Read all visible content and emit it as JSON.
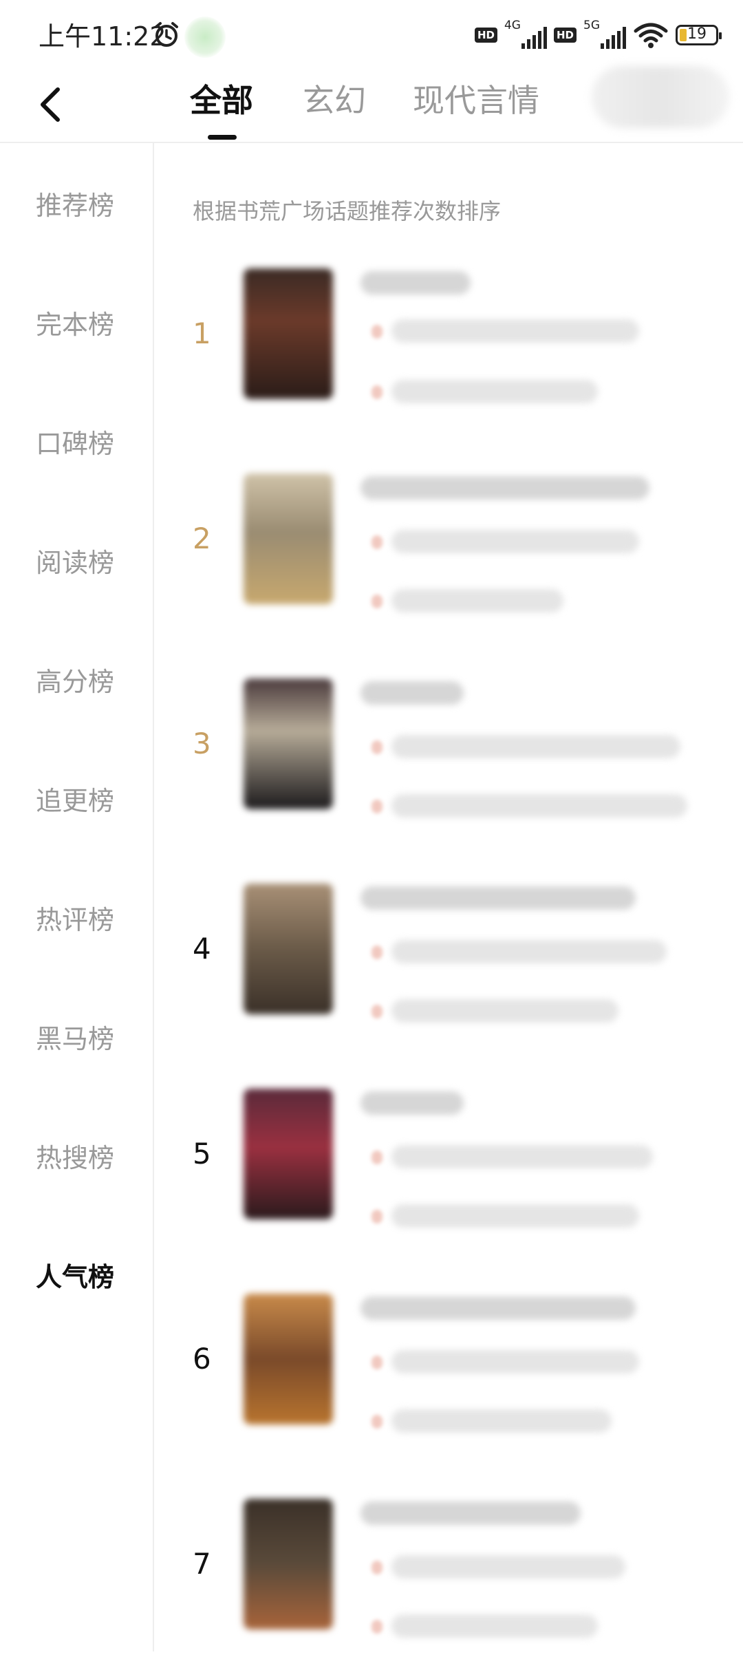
{
  "status_bar": {
    "time": "上午11:22",
    "net1_label": "4G",
    "net2_label": "5G",
    "hd1": "HD",
    "hd2": "HD",
    "battery": "19"
  },
  "tabs": [
    {
      "label": "全部",
      "active": true
    },
    {
      "label": "玄幻",
      "active": false
    },
    {
      "label": "现代言情",
      "active": false
    }
  ],
  "sidebar": {
    "items": [
      {
        "label": "推荐榜"
      },
      {
        "label": "完本榜"
      },
      {
        "label": "口碑榜"
      },
      {
        "label": "阅读榜"
      },
      {
        "label": "高分榜"
      },
      {
        "label": "追更榜"
      },
      {
        "label": "热评榜"
      },
      {
        "label": "黑马榜"
      },
      {
        "label": "热搜榜"
      },
      {
        "label": "人气榜",
        "active": true
      }
    ]
  },
  "list": {
    "hint": "根据书荒广场话题推荐次数排序",
    "ranks": [
      "1",
      "2",
      "3",
      "4",
      "5",
      "6",
      "7"
    ]
  },
  "colors": {
    "rank_top": "#c8a063",
    "rank_other": "#111111",
    "inactive_text": "#999999",
    "battery_fill": "#e8b832"
  }
}
